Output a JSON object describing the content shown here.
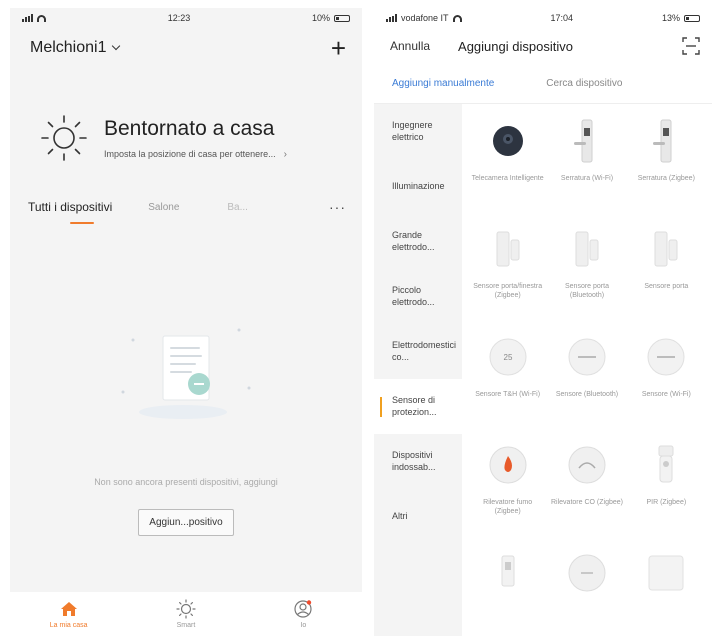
{
  "left": {
    "status": {
      "time": "12:23",
      "battery": "10%"
    },
    "home_name": "Melchioni1",
    "welcome_title": "Bentornato a casa",
    "welcome_sub": "Imposta la posizione di casa per ottenere...",
    "tabs": [
      {
        "label": "Tutti i dispositivi"
      },
      {
        "label": "Salone"
      },
      {
        "label": "Ba..."
      }
    ],
    "empty_text": "Non sono ancora presenti dispositivi, aggiungi",
    "add_button": "Aggiun...positivo",
    "nav": [
      {
        "label": "La mia casa",
        "icon": "home-icon"
      },
      {
        "label": "Smart",
        "icon": "sun-icon"
      },
      {
        "label": "Io",
        "icon": "profile-icon"
      }
    ],
    "accent": "#f07b2c"
  },
  "right": {
    "status": {
      "carrier": "vodafone IT",
      "time": "17:04",
      "battery": "13%"
    },
    "cancel": "Annulla",
    "title": "Aggiungi dispositivo",
    "tabs": {
      "manual": "Aggiungi manualmente",
      "search": "Cerca dispositivo"
    },
    "categories": [
      {
        "label": "Ingegnere elettrico"
      },
      {
        "label": "Illuminazione"
      },
      {
        "label": "Grande elettrodo..."
      },
      {
        "label": "Piccolo elettrodo..."
      },
      {
        "label": "Elettrodomestici co..."
      },
      {
        "label": "Sensore di protezion..."
      },
      {
        "label": "Dispositivi indossab..."
      },
      {
        "label": "Altri"
      }
    ],
    "devices": [
      {
        "label": "Telecamera Intelligente",
        "icon": "camera-icon"
      },
      {
        "label": "Serratura (Wi-Fi)",
        "icon": "door-lock-icon"
      },
      {
        "label": "Serratura (Zigbee)",
        "icon": "door-lock-icon"
      },
      {
        "label": "Sensore porta/finestra (Zigbee)",
        "icon": "contact-sensor-icon"
      },
      {
        "label": "Sensore porta (Bluetooth)",
        "icon": "contact-sensor-icon"
      },
      {
        "label": "Sensore porta",
        "icon": "contact-sensor-icon"
      },
      {
        "label": "Sensore T&H (Wi-Fi)",
        "icon": "thermo-hygro-icon"
      },
      {
        "label": "Sensore (Bluetooth)",
        "icon": "thermo-hygro-icon"
      },
      {
        "label": "Sensore (Wi-Fi)",
        "icon": "thermo-hygro-icon"
      },
      {
        "label": "Rilevatore fumo (Zigbee)",
        "icon": "smoke-detector-icon"
      },
      {
        "label": "Rilevatore CO (Zigbee)",
        "icon": "co-detector-icon"
      },
      {
        "label": "PIR (Zigbee)",
        "icon": "pir-sensor-icon"
      },
      {
        "label": "",
        "icon": "plug-icon"
      },
      {
        "label": "",
        "icon": "round-sensor-icon"
      },
      {
        "label": "",
        "icon": "square-sensor-icon"
      }
    ],
    "active_tab_color": "#3a7bd5",
    "active_category_color": "#f0a020"
  }
}
